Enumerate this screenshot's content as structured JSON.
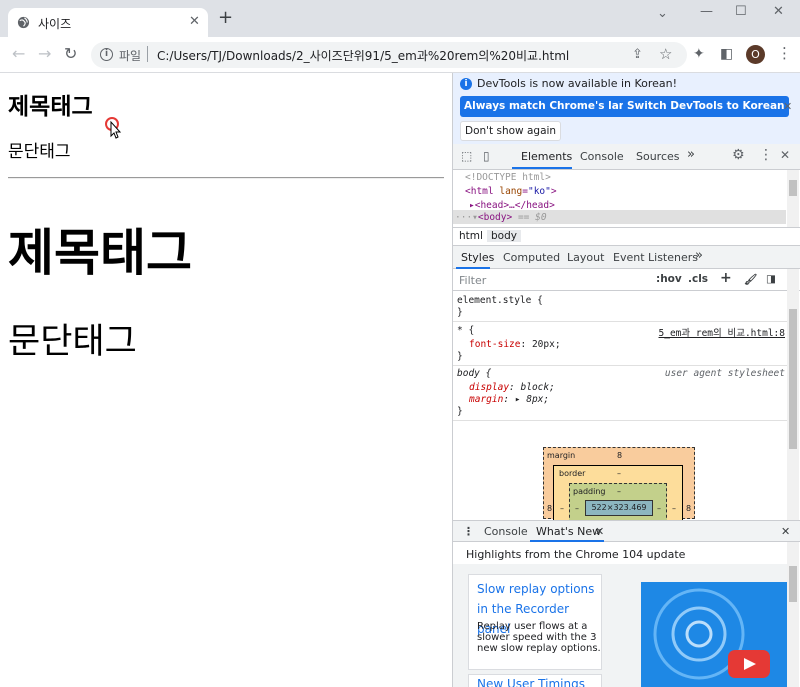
{
  "browser": {
    "tab_title": "사이즈",
    "new_tab_label": "+",
    "address": {
      "scheme_label": "파일",
      "url": "C:/Users/TJ/Downloads/2_사이즈단위91/5_em과%20rem의%20비교.html"
    },
    "avatar_initial": "O",
    "window_controls": [
      "⌄",
      "—",
      "☐",
      "✕"
    ]
  },
  "page": {
    "h1_small": "제목태그",
    "p_small": "문단태그",
    "h1_large": "제목태그",
    "p_large": "문단태그"
  },
  "devtools": {
    "infobar": {
      "message": "DevTools is now available in Korean!",
      "btn_match": "Always match Chrome's language",
      "btn_switch": "Switch DevTools to Korean",
      "btn_dont_show": "Don't show again"
    },
    "tabs": [
      "Elements",
      "Console",
      "Sources"
    ],
    "more_tabs": "»",
    "dom": {
      "doctype": "<!DOCTYPE html>",
      "html_open": "<html",
      "html_attr": "lang",
      "html_val": "\"ko\"",
      "head": "<head>…</head>",
      "body": "<body>",
      "body_eq": "== $0"
    },
    "breadcrumbs": [
      "html",
      "body"
    ],
    "style_tabs": [
      "Styles",
      "Computed",
      "Layout",
      "Event Listeners"
    ],
    "filter_placeholder": "Filter",
    "filter_tools": [
      ":hov",
      ".cls",
      "+"
    ],
    "rules": {
      "element_style": "element.style {",
      "close": "}",
      "universal_selector": "* {",
      "universal_source": "5_em과 rem의 비교.html:8",
      "font_size_prop": "font-size",
      "font_size_val": "20px;",
      "body_selector": "body {",
      "body_source": "user agent stylesheet",
      "display_prop": "display",
      "display_val": "block;",
      "margin_prop": "margin",
      "margin_val": "8px;"
    },
    "box_model": {
      "margin_label": "margin",
      "margin_value": "8",
      "border_label": "border",
      "border_value": "–",
      "padding_label": "padding",
      "padding_value": "–",
      "content_size": "522×323.469",
      "left_margin": "8",
      "right_margin": "8",
      "dash": "–"
    },
    "drawer": {
      "tabs": [
        "Console",
        "What's New"
      ],
      "heading": "Highlights from the Chrome 104 update",
      "card1_title": "Slow replay options in the Recorder panel",
      "card1_desc": "Replay user flows at a slower speed with the 3 new slow replay options.",
      "card2_title": "New User Timings"
    }
  },
  "colors": {
    "accent": "#1a73e8",
    "tab_strip": "#dee1e6",
    "infobar_bg": "#e8f0fe"
  },
  "icons": [
    "globe-icon",
    "back-icon",
    "forward-icon",
    "reload-icon",
    "info-icon",
    "share-icon",
    "star-icon",
    "extensions-icon",
    "side-panel-icon",
    "kebab-icon",
    "inspect-icon",
    "device-icon",
    "gear-icon",
    "close-icon",
    "youtube-play-icon"
  ]
}
